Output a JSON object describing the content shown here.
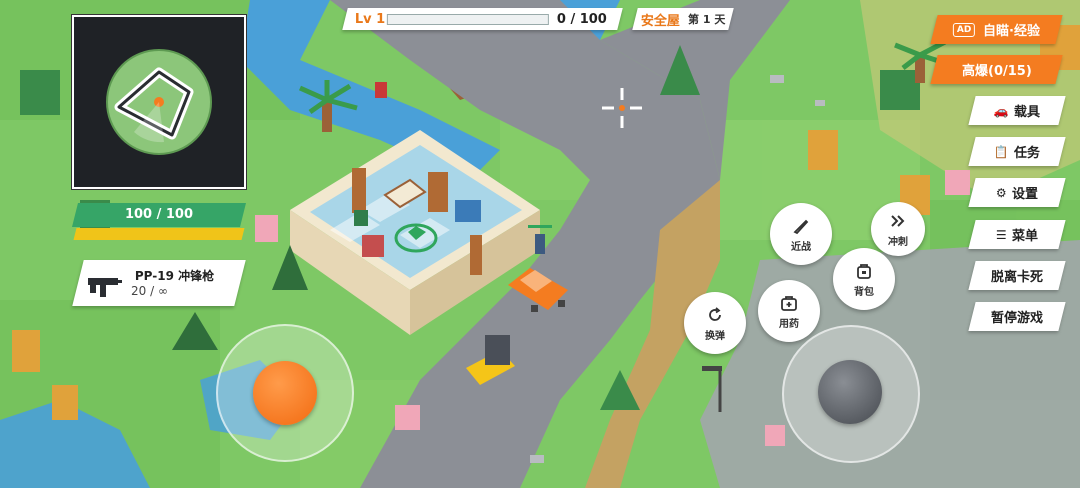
{
  "hud": {
    "level_label": "Lv 1",
    "xp_text": "0 / 100",
    "xp_fraction": 0.0,
    "location": "安全屋",
    "day": "第 1 天"
  },
  "player": {
    "hp_text": "100 / 100",
    "hp_fraction": 1.0,
    "stamina_fraction": 1.0
  },
  "weapon": {
    "name": "PP-19 冲锋枪",
    "ammo": "20 / ∞"
  },
  "right_menu": {
    "ad_tag": "AD",
    "ad_label": "自瞄·经验",
    "burst_label": "高爆(0/15)",
    "vehicle_label": "载具",
    "task_label": "任务",
    "settings_label": "设置",
    "menu_label": "菜单",
    "unstuck_label": "脱离卡死",
    "pause_label": "暂停游戏"
  },
  "actions": {
    "melee": "近战",
    "dash": "冲刺",
    "bag": "背包",
    "medicine": "用药",
    "reload": "换弹"
  },
  "colors": {
    "accent_orange": "#f47c20",
    "health_green": "#36a567",
    "stamina_yellow": "#f0c419",
    "grass": "#7ec865"
  },
  "icons": {
    "vehicle": "car-icon",
    "task": "clipboard-icon",
    "settings": "gear-icon",
    "menu": "hamburger-icon",
    "melee": "knife-icon",
    "dash": "double-chevron-icon",
    "bag": "backpack-icon",
    "medicine": "medkit-icon",
    "reload": "reload-icon",
    "weapon": "smg-icon"
  }
}
